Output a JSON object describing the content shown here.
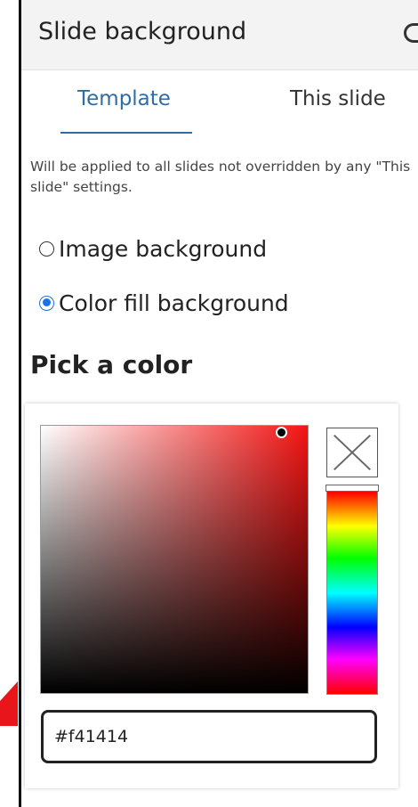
{
  "panel": {
    "title": "Slide background"
  },
  "tabs": [
    {
      "label": "Template",
      "active": true
    },
    {
      "label": "This slide",
      "active": false
    }
  ],
  "description": "Will be applied to all slides not overridden by any \"This slide\" settings.",
  "background_options": [
    {
      "label": "Image background",
      "checked": false
    },
    {
      "label": "Color fill background",
      "checked": true
    }
  ],
  "color_picker": {
    "title": "Pick a color",
    "hex_value": "#f41414",
    "hue_color": "#f41414",
    "clear_icon": "x-icon"
  },
  "colors": {
    "accent": "#2e6da4",
    "radio_checked": "#1a73e8",
    "annotation_arrow": "#e8151b"
  }
}
